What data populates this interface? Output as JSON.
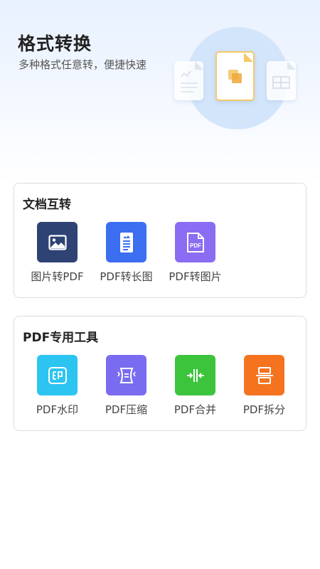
{
  "header": {
    "title": "格式转换",
    "subtitle": "多种格式任意转，便捷快速"
  },
  "sections": [
    {
      "title": "文档互转",
      "tools": [
        {
          "label": "图片转PDF",
          "icon": "image-icon",
          "color": "#2e4374"
        },
        {
          "label": "PDF转长图",
          "icon": "long-image-icon",
          "color": "#3b6ef0"
        },
        {
          "label": "PDF转图片",
          "icon": "pdf-file-icon",
          "color": "#8a6df2",
          "icon_text": "PDF"
        }
      ]
    },
    {
      "title": "PDF专用工具",
      "tools": [
        {
          "label": "PDF水印",
          "icon": "watermark-icon",
          "color": "#2cc4f0"
        },
        {
          "label": "PDF压缩",
          "icon": "compress-icon",
          "color": "#7a6cf0"
        },
        {
          "label": "PDF合并",
          "icon": "merge-icon",
          "color": "#3cc43c"
        },
        {
          "label": "PDF拆分",
          "icon": "split-icon",
          "color": "#f5731f"
        }
      ]
    }
  ]
}
